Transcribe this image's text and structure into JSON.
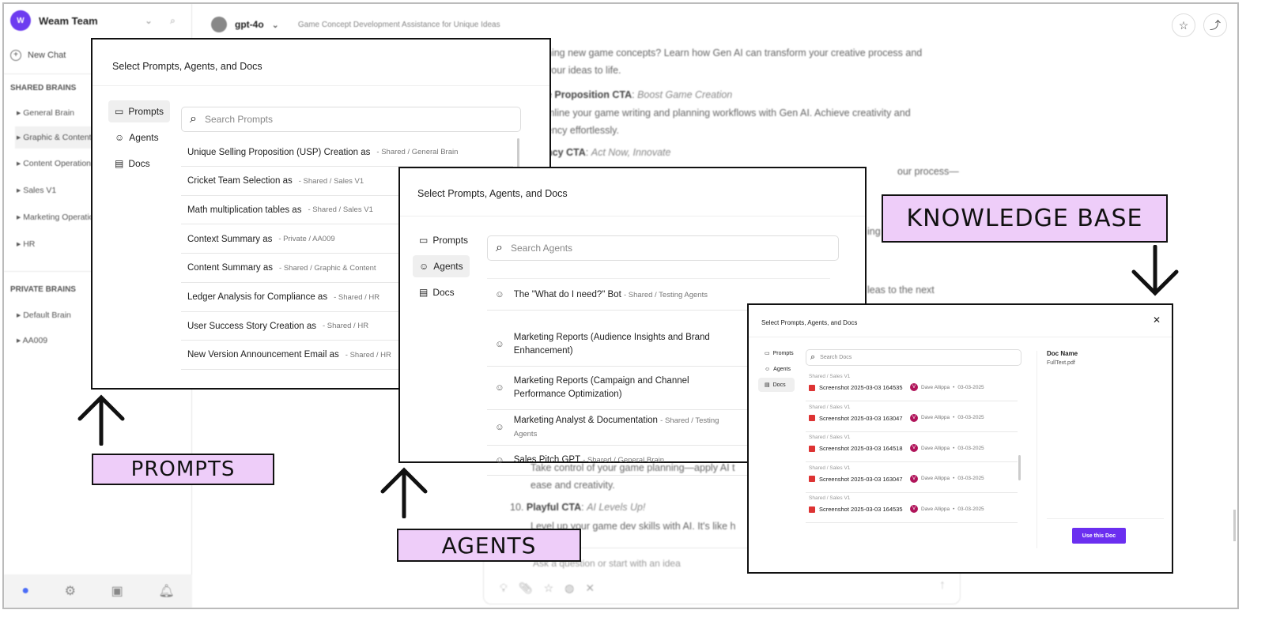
{
  "sidebar": {
    "team": "Weam Team",
    "logo": "W",
    "new_chat": "New Chat",
    "shared_heading": "SHARED BRAINS",
    "shared": [
      "General Brain",
      "Graphic & Content",
      "Content Operations",
      "Sales V1",
      "Marketing Operations",
      "HR"
    ],
    "private_heading": "PRIVATE BRAINS",
    "private": [
      "Default Brain",
      "AA009"
    ],
    "bottom_icons": [
      "user-icon",
      "settings-icon",
      "note-icon",
      "bell-icon"
    ]
  },
  "header": {
    "model": "gpt-4o",
    "chat_title": "Game Concept Development Assistance for Unique Ideas"
  },
  "chat": {
    "l1": "ning new game concepts? Learn how Gen AI can transform your creative process and",
    "l2": "your ideas to life.",
    "l3b": "e Proposition CTA",
    "l3i": "Boost Game Creation",
    "l4": "mline your game writing and planning workflows with Gen AI. Achieve creativity and",
    "l5": "ency effortlessly.",
    "l6b": "ncy CTA",
    "l6i": "Act Now, Innovate",
    "l7": "our process—",
    "l8": "ing",
    "l9": "leas to the next",
    "l10": "Take control of your game planning—apply AI t",
    "l11": "ease and creativity.",
    "l12n": "10.",
    "l12b": "Playful CTA",
    "l12i": "AI Levels Up!",
    "l13": "Level up your game dev skills with AI. It's like h",
    "input_placeholder": "Ask a question or start with an idea"
  },
  "modal_title": "Select Prompts, Agents, and Docs",
  "tabs": {
    "prompts": "Prompts",
    "agents": "Agents",
    "docs": "Docs"
  },
  "prompts": {
    "search_placeholder": "Search Prompts",
    "items": [
      {
        "name": "Unique Selling Proposition (USP) Creation as",
        "meta": "- Shared / General Brain"
      },
      {
        "name": "Cricket Team Selection as",
        "meta": "- Shared / Sales V1"
      },
      {
        "name": "Math multiplication tables as",
        "meta": "- Shared / Sales V1"
      },
      {
        "name": "Context Summary as",
        "meta": "- Private / AA009"
      },
      {
        "name": "Content Summary as",
        "meta": "- Shared / Graphic & Content"
      },
      {
        "name": "Ledger Analysis for Compliance as",
        "meta": "- Shared / HR"
      },
      {
        "name": "User Success Story Creation as",
        "meta": "- Shared / HR"
      },
      {
        "name": "New Version Announcement Email as",
        "meta": "- Shared / HR"
      }
    ]
  },
  "agents": {
    "search_placeholder": "Search Agents",
    "items": [
      {
        "name": "The \"What do I need?\" Bot",
        "meta": "- Shared / Testing Agents"
      },
      {
        "name": "Marketing Reports (Audience Insights and Brand Enhancement)",
        "meta": ""
      },
      {
        "name": "Marketing Reports (Campaign and Channel Performance Optimization)",
        "meta": ""
      },
      {
        "name": "Marketing Analyst & Documentation",
        "meta": "- Shared / Testing Agents"
      },
      {
        "name": "Sales Pitch GPT",
        "meta": "- Shared / General Brain"
      }
    ]
  },
  "docs": {
    "search_placeholder": "Search Docs",
    "doc_name_label": "Doc Name",
    "doc_name": "FullText.pdf",
    "use_button": "Use this Doc",
    "accent": "#6b2ff0",
    "items": [
      {
        "path": "Shared / Sales V1",
        "file": "Screenshot 2025-03-03 164535",
        "avatar": "V",
        "user": "Dave Allippa",
        "date": "03-03-2025"
      },
      {
        "path": "Shared / Sales V1",
        "file": "Screenshot 2025-03-03 163047",
        "avatar": "V",
        "user": "Dave Allippa",
        "date": "03-03-2025"
      },
      {
        "path": "Shared / Sales V1",
        "file": "Screenshot 2025-03-03 164518",
        "avatar": "V",
        "user": "Dave Allippa",
        "date": "03-03-2025"
      },
      {
        "path": "Shared / Sales V1",
        "file": "Screenshot 2025-03-03 163047",
        "avatar": "V",
        "user": "Dave Allippa",
        "date": "03-03-2025"
      },
      {
        "path": "Shared / Sales V1",
        "file": "Screenshot 2025-03-03 164535",
        "avatar": "V",
        "user": "Dave Allippa",
        "date": "03-03-2025"
      }
    ]
  },
  "callouts": {
    "prompts": "PROMPTS",
    "agents": "AGENTS",
    "knowledge": "KNOWLEDGE BASE",
    "color": "#eecdf9"
  }
}
